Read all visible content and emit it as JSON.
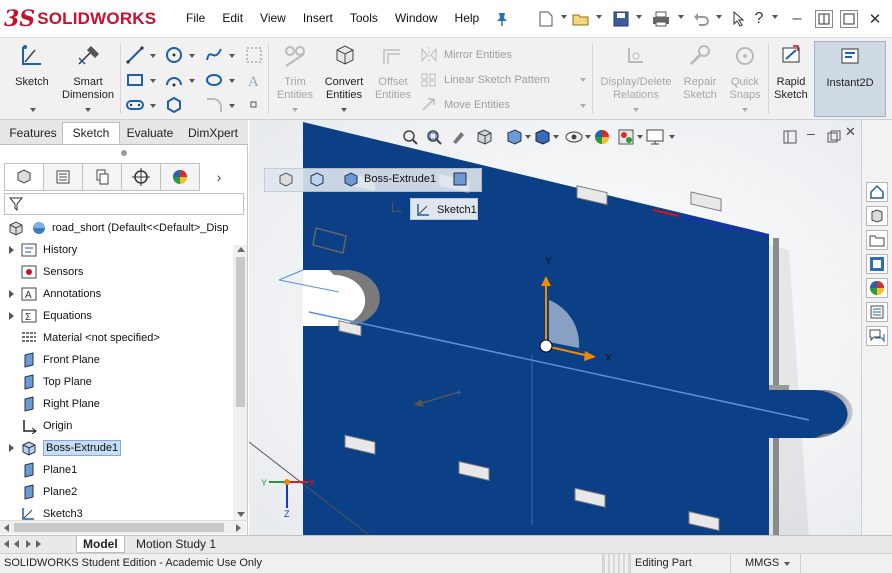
{
  "app": {
    "logo_ds": "3S",
    "logo_text": "SOLIDWORKS"
  },
  "menu": [
    "File",
    "Edit",
    "View",
    "Insert",
    "Tools",
    "Window",
    "Help"
  ],
  "command_manager": {
    "sketch": "Sketch",
    "smart_dimension_line1": "Smart",
    "smart_dimension_line2": "Dimension",
    "trim_line1": "Trim",
    "trim_line2": "Entities",
    "convert_line1": "Convert",
    "convert_line2": "Entities",
    "offset_line1": "Offset",
    "offset_line2": "Entities",
    "mirror": "Mirror Entities",
    "linear_pattern": "Linear Sketch Pattern",
    "move": "Move Entities",
    "display_delete_line1": "Display/Delete",
    "display_delete_line2": "Relations",
    "repair_line1": "Repair",
    "repair_line2": "Sketch",
    "quick_snaps_line1": "Quick",
    "quick_snaps_line2": "Snaps",
    "rapid_line1": "Rapid",
    "rapid_line2": "Sketch",
    "instant2d": "Instant2D"
  },
  "cm_tabs": [
    "Features",
    "Sketch",
    "Evaluate",
    "DimXpert"
  ],
  "tree": {
    "root": "road_short  (Default<<Default>_Disp",
    "items": [
      {
        "label": "History",
        "expandable": true
      },
      {
        "label": "Sensors",
        "expandable": false
      },
      {
        "label": "Annotations",
        "expandable": true
      },
      {
        "label": "Equations",
        "expandable": true
      },
      {
        "label": "Material <not specified>",
        "expandable": false
      },
      {
        "label": "Front Plane",
        "expandable": false
      },
      {
        "label": "Top Plane",
        "expandable": false
      },
      {
        "label": "Right Plane",
        "expandable": false
      },
      {
        "label": "Origin",
        "expandable": false
      },
      {
        "label": "Boss-Extrude1",
        "expandable": true,
        "selected": true
      },
      {
        "label": "Plane1",
        "expandable": false
      },
      {
        "label": "Plane2",
        "expandable": false
      },
      {
        "label": "Sketch3",
        "expandable": false
      }
    ]
  },
  "breadcrumb": {
    "feature": "Boss-Extrude1",
    "sketch": "Sketch1"
  },
  "axes": {
    "x": "X",
    "y": "Y",
    "z": "Z"
  },
  "model_tabs": [
    "Model",
    "Motion Study 1"
  ],
  "status": {
    "edition": "SOLIDWORKS Student Edition - Academic Use Only",
    "mode": "Editing Part",
    "units": "MMGS"
  },
  "colors": {
    "part_blue": "#0b3f86",
    "brand_red": "#c8102e",
    "selection_blue": "#c6ddf5"
  }
}
